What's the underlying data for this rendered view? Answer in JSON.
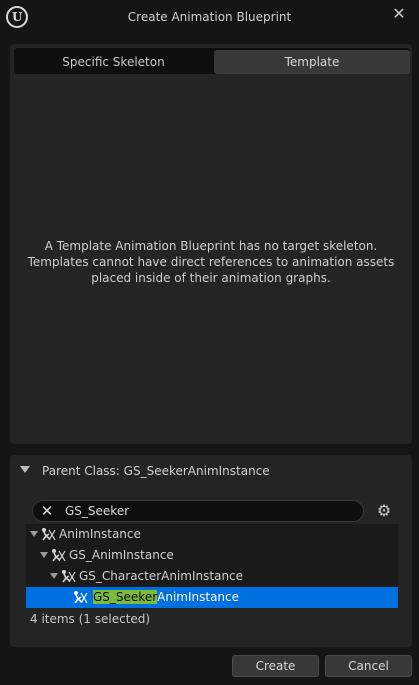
{
  "window": {
    "title": "Create Animation Blueprint",
    "close_glyph": "✕",
    "logo_glyph": "U"
  },
  "tabs": [
    {
      "label": "Specific Skeleton",
      "selected": false
    },
    {
      "label": "Template",
      "selected": true
    }
  ],
  "info_text": "A Template Animation Blueprint has no target skeleton. Templates cannot have direct references to animation assets placed inside of their animation graphs.",
  "parent_class": {
    "header_label": "Parent Class: GS_SeekerAnimInstance",
    "search": {
      "value": "GS_Seeker",
      "placeholder": ""
    },
    "tree": [
      {
        "label": "AnimInstance",
        "depth": 0,
        "expanded": true,
        "selected": false
      },
      {
        "label": "GS_AnimInstance",
        "depth": 1,
        "expanded": true,
        "selected": false
      },
      {
        "label": "GS_CharacterAnimInstance",
        "depth": 2,
        "expanded": true,
        "selected": false
      },
      {
        "label_match": "GS_Seeker",
        "label_rest": "AnimInstance",
        "depth": 3,
        "expanded": false,
        "selected": true
      }
    ],
    "status": "4 items (1 selected)"
  },
  "buttons": {
    "create": "Create",
    "cancel": "Cancel"
  },
  "icons": {
    "logo": "unreal-logo-icon",
    "close": "close-icon",
    "clear": "clear-search-icon",
    "settings": "gear-icon",
    "class": "anim-class-icon",
    "expander": "triangle-down-icon"
  },
  "colors": {
    "background": "#151515",
    "panel": "#242424",
    "selection": "#0070e0",
    "search_highlight": "#7dbb3a"
  }
}
